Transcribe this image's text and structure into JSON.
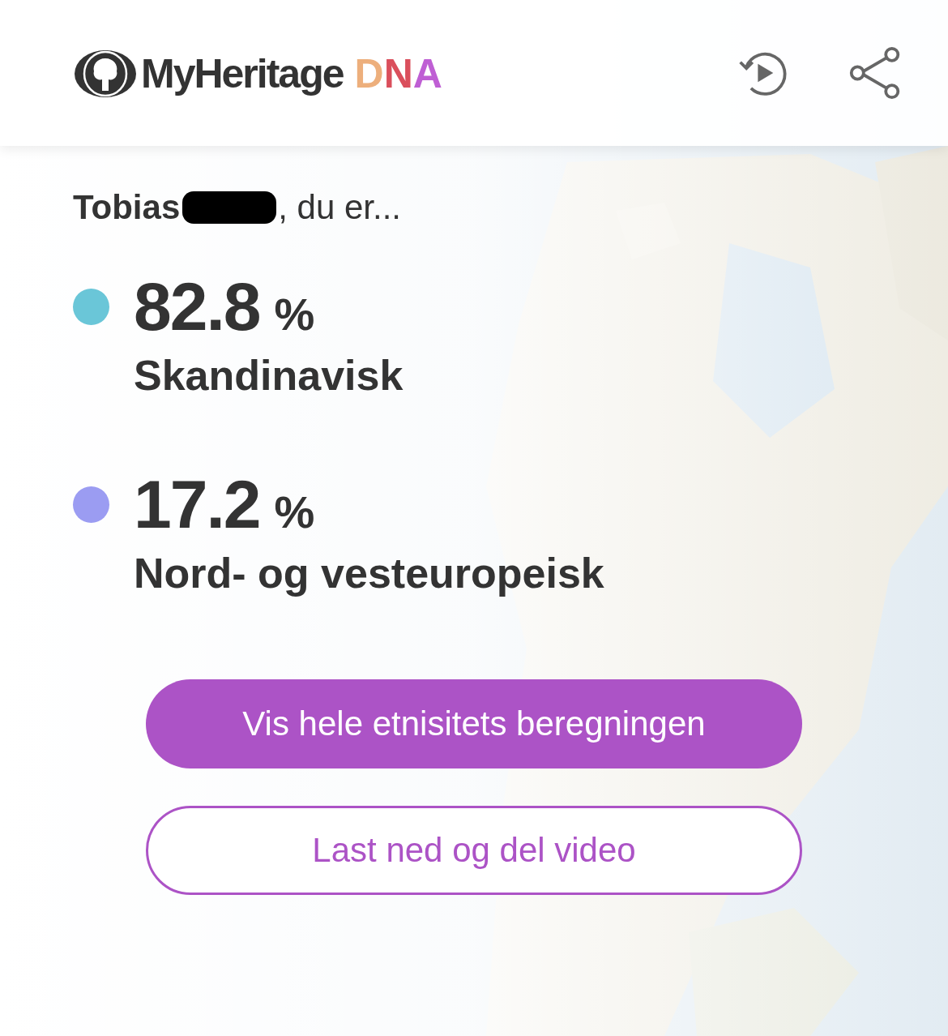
{
  "header": {
    "logo": {
      "name": "MyHeritage",
      "suffix": "DNA"
    }
  },
  "greeting": {
    "name": "Tobias",
    "rest": ", du er..."
  },
  "ethnicities": [
    {
      "percent": "82.8",
      "unit": "%",
      "name": "Skandinavisk",
      "color": "#6ac6d8"
    },
    {
      "percent": "17.2",
      "unit": "%",
      "name": "Nord- og vesteuropeisk",
      "color": "#9b9cf2"
    }
  ],
  "buttons": [
    {
      "label": "Vis hele etnisitets beregningen",
      "kind": "primary"
    },
    {
      "label": "Last ned og del video",
      "kind": "outline"
    }
  ]
}
